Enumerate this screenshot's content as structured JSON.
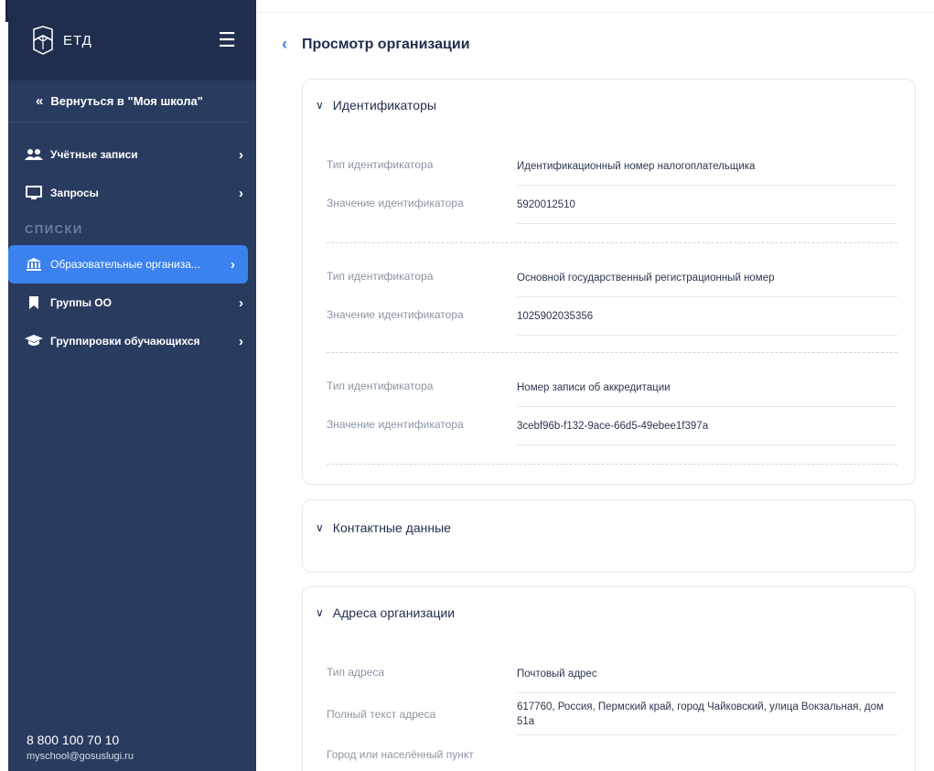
{
  "sidebar": {
    "logo_text": "ЕТД",
    "back_link": "Вернуться в \"Моя школа\"",
    "items_top": [
      {
        "label": "Учётные записи",
        "icon": "users-icon"
      },
      {
        "label": "Запросы",
        "icon": "monitor-icon"
      }
    ],
    "section_label": "СПИСКИ",
    "items_lists": [
      {
        "label": "Образовательные организа...",
        "icon": "institution-icon",
        "active": true
      },
      {
        "label": "Группы ОО",
        "icon": "bookmark-icon"
      },
      {
        "label": "Группировки обучающихся",
        "icon": "graduation-cap-icon"
      }
    ],
    "phone": "8 800 100 70 10",
    "email": "myschool@gosuslugi.ru"
  },
  "page": {
    "title": "Просмотр организации"
  },
  "identifiers": {
    "title": "Идентификаторы",
    "groups": [
      {
        "type_label": "Тип идентификатора",
        "type_value": "Идентификационный номер налогоплательщика",
        "value_label": "Значение идентификатора",
        "value": "5920012510"
      },
      {
        "type_label": "Тип идентификатора",
        "type_value": "Основной государственный регистрационный номер",
        "value_label": "Значение идентификатора",
        "value": "1025902035356"
      },
      {
        "type_label": "Тип идентификатора",
        "type_value": "Номер записи об аккредитации",
        "value_label": "Значение идентификатора",
        "value": "3cebf96b-f132-9ace-66d5-49ebee1f397a"
      }
    ]
  },
  "contacts": {
    "title": "Контактные данные"
  },
  "addresses": {
    "title": "Адреса организации",
    "rows": [
      {
        "label": "Тип адреса",
        "value": "Почтовый адрес"
      },
      {
        "label": "Полный текст адреса",
        "value": "617760, Россия, Пермский край, город Чайковский, улица Вокзальная, дом 51а"
      },
      {
        "label": "Город или населённый пункт",
        "value": ""
      }
    ]
  },
  "colors": {
    "sidebar_bg": "#293b5e",
    "sidebar_header_bg": "#1f2e4d",
    "accent": "#3b82f0"
  }
}
